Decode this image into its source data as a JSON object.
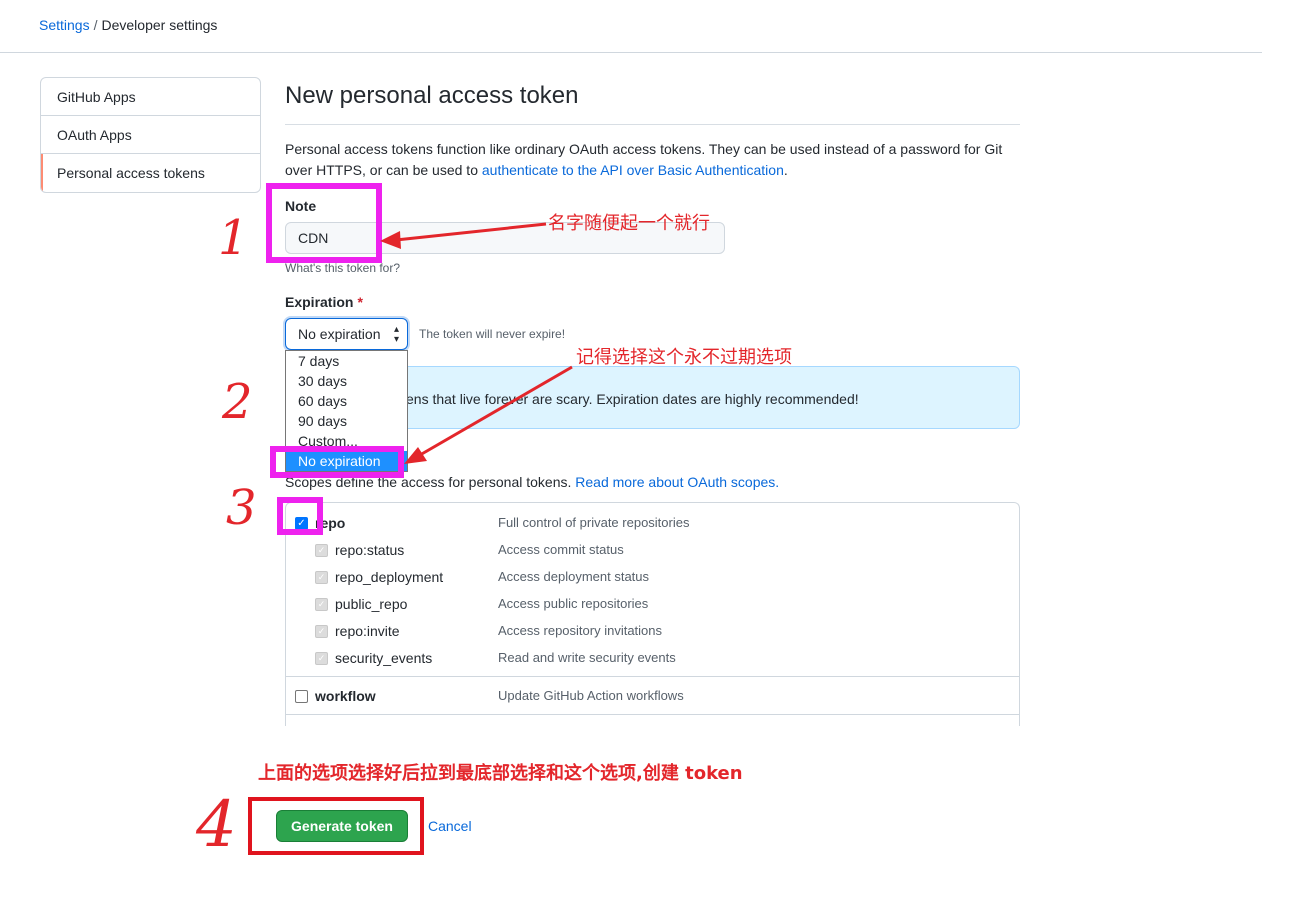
{
  "breadcrumb": {
    "settings": "Settings",
    "separator": "/",
    "current": "Developer settings"
  },
  "sidebar": {
    "items": [
      {
        "label": "GitHub Apps"
      },
      {
        "label": "OAuth Apps"
      },
      {
        "label": "Personal access tokens"
      }
    ]
  },
  "main": {
    "title": "New personal access token",
    "description": "Personal access tokens function like ordinary OAuth access tokens. They can be used instead of a password for Git over HTTPS, or can be used to ",
    "description_link": "authenticate to the API over Basic Authentication",
    "description_end": ".",
    "note": {
      "label": "Note",
      "value": "CDN",
      "hint": "What's this token for?"
    },
    "expiration": {
      "label": "Expiration",
      "required_mark": "*",
      "selected": "No expiration",
      "hint": "The token will never expire!",
      "options": [
        "7 days",
        "30 days",
        "60 days",
        "90 days",
        "Custom...",
        "No expiration"
      ]
    },
    "flash_text": "kens that live forever are scary. Expiration dates are highly recommended!",
    "scopes_intro": "Scopes define the access for personal tokens. ",
    "scopes_link": "Read more about OAuth scopes.",
    "scopes": [
      {
        "name": "repo",
        "desc": "Full control of private repositories",
        "checked": true
      },
      {
        "name": "repo:status",
        "desc": "Access commit status"
      },
      {
        "name": "repo_deployment",
        "desc": "Access deployment status"
      },
      {
        "name": "public_repo",
        "desc": "Access public repositories"
      },
      {
        "name": "repo:invite",
        "desc": "Access repository invitations"
      },
      {
        "name": "security_events",
        "desc": "Read and write security events"
      },
      {
        "name": "workflow",
        "desc": "Update GitHub Action workflows",
        "checked": false
      }
    ],
    "generate_button": "Generate token",
    "cancel_link": "Cancel"
  },
  "annotations": {
    "step1_number": "1",
    "step1_text": "名字随便起一个就行",
    "step2_number": "2",
    "step2_text": "记得选择这个永不过期选项",
    "step3_number": "3",
    "step4_number": "4",
    "step4_text": "上面的选项选择好后拉到最底部选择和这个选项,创建 token"
  },
  "colors": {
    "link": "#0969da",
    "primary_button": "#2da44e",
    "annotation_red": "#e3262b",
    "annotation_magenta": "#ee22ee",
    "selected_option": "#1e90ff"
  }
}
